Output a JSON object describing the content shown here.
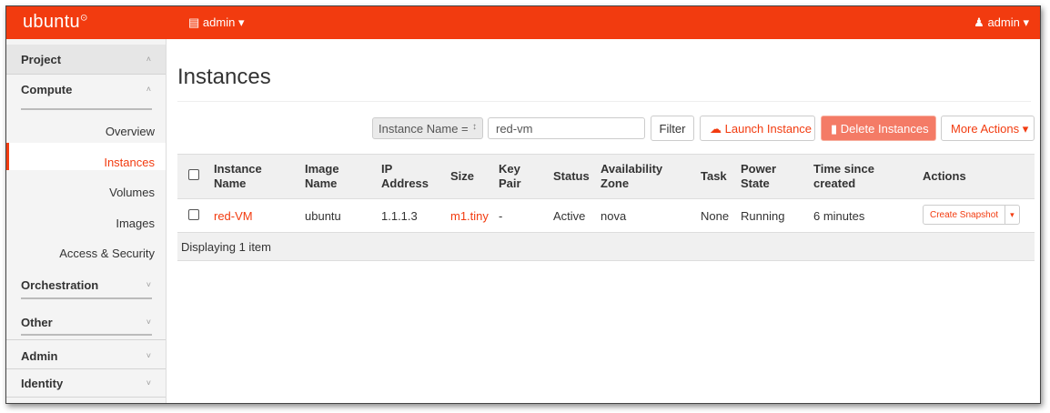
{
  "brand": {
    "logo_text": "ubuntu",
    "logo_mark": "⊙",
    "accent": "#f23b0f"
  },
  "topbar": {
    "project_menu_label": "admin ▾",
    "project_icon": "▤",
    "user_menu_label": "admin ▾",
    "user_icon": "♟"
  },
  "sidebar": {
    "project": {
      "label": "Project",
      "chevron": "˄"
    },
    "compute": {
      "label": "Compute",
      "chevron": "˄",
      "items": [
        "Overview",
        "Instances",
        "Volumes",
        "Images",
        "Access & Security"
      ],
      "active": "Instances"
    },
    "orchestration": {
      "label": "Orchestration",
      "chevron": "˅"
    },
    "other": {
      "label": "Other",
      "chevron": "˅"
    },
    "admin": {
      "label": "Admin",
      "chevron": "˅"
    },
    "identity": {
      "label": "Identity",
      "chevron": "˅"
    }
  },
  "main": {
    "title": "Instances",
    "filter_select": {
      "value": "Instance Name =",
      "arrow": "↕"
    },
    "search": {
      "value": "red-vm"
    },
    "buttons": {
      "filter": "Filter",
      "launch": "Launch Instance",
      "launch_icon": "☁",
      "delete": "Delete Instances",
      "delete_icon": "▮",
      "more": "More Actions ▾"
    },
    "table": {
      "headers": {
        "name": [
          "Instance",
          "Name"
        ],
        "image": [
          "Image",
          "Name"
        ],
        "ip": [
          "IP",
          "Address"
        ],
        "size": "Size",
        "keypair": [
          "Key",
          "Pair"
        ],
        "status": "Status",
        "zone": [
          "Availability",
          "Zone"
        ],
        "task": "Task",
        "power": [
          "Power",
          "State"
        ],
        "time": [
          "Time since",
          "created"
        ],
        "actions": "Actions"
      },
      "rows": [
        {
          "name": "red-VM",
          "image": "ubuntu",
          "ip": "1.1.1.3",
          "size": "m1.tiny",
          "keypair": "-",
          "status": "Active",
          "zone": "nova",
          "task": "None",
          "power": "Running",
          "time": "6 minutes",
          "action": "Create Snapshot",
          "action_arrow": "▾"
        }
      ],
      "footer": "Displaying 1 item"
    }
  }
}
